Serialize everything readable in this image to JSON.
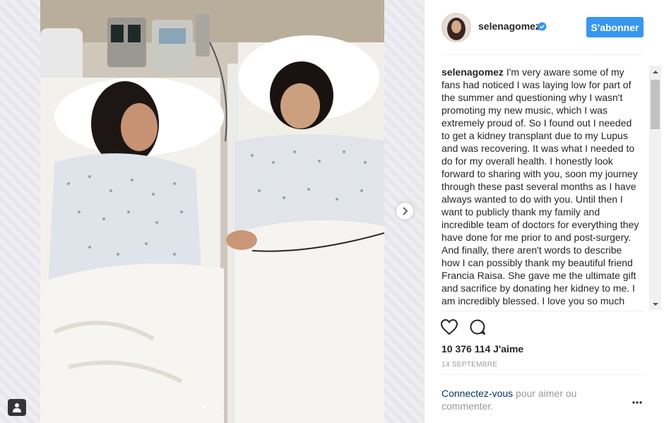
{
  "post": {
    "username": "selenagomez",
    "verified": true,
    "follow_label": "S'abonner",
    "caption_user": "selenagomez",
    "caption_text": " I'm very aware some of my fans had noticed I was laying low for part of the summer and questioning why I wasn't promoting my new music, which I was extremely proud of. So I found out I needed to get a kidney transplant due to my Lupus and was recovering. It was what I needed to do for my overall health. I honestly look forward to sharing with you, soon my journey through these past several months as I have always wanted to do with you. Until then I want to publicly thank my family and incredible team of doctors for everything they have done for me prior to and post-surgery. And finally, there aren't words to describe how I can possibly thank my beautiful friend Francia Raisa. She gave me the ultimate gift and sacrifice by donating her kidney to me. I am incredibly blessed. I love you so much sis.",
    "likes_label": "10 376 114 J'aime",
    "date_label": "14 SEPTEMBRE",
    "login_link": "Connectez-vous",
    "login_rest": " pour aimer ou commenter.",
    "more_label": "•••"
  },
  "carousel": {
    "total": 3,
    "active": 0
  },
  "icons": {
    "like": "heart-icon",
    "comment": "comment-bubble-icon",
    "next": "chevron-right-icon",
    "tag": "user-tag-icon",
    "verified": "verified-badge-icon"
  },
  "colors": {
    "accent": "#3897f0",
    "link": "#003569",
    "muted": "#999999",
    "text": "#262626"
  }
}
